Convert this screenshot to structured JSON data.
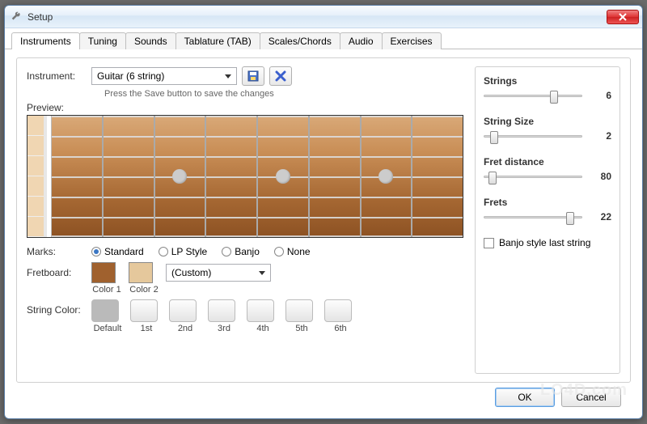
{
  "window": {
    "title": "Setup"
  },
  "tabs": {
    "items": [
      {
        "label": "Instruments",
        "active": true
      },
      {
        "label": "Tuning"
      },
      {
        "label": "Sounds"
      },
      {
        "label": "Tablature (TAB)"
      },
      {
        "label": "Scales/Chords"
      },
      {
        "label": "Audio"
      },
      {
        "label": "Exercises"
      }
    ]
  },
  "instrument": {
    "label": "Instrument:",
    "value": "Guitar (6 string)",
    "hint": "Press the Save button to save the changes"
  },
  "preview": {
    "label": "Preview:"
  },
  "marks": {
    "label": "Marks:",
    "options": [
      {
        "label": "Standard",
        "checked": true
      },
      {
        "label": "LP Style",
        "checked": false
      },
      {
        "label": "Banjo",
        "checked": false
      },
      {
        "label": "None",
        "checked": false
      }
    ]
  },
  "fretboard": {
    "label": "Fretboard:",
    "color1": "#a0612e",
    "color2": "#e5c89c",
    "custom_label": "(Custom)",
    "col1_label": "Color 1",
    "col2_label": "Color 2"
  },
  "string_color": {
    "label": "String Color:",
    "labels": [
      "Default",
      "1st",
      "2nd",
      "3rd",
      "4th",
      "5th",
      "6th"
    ]
  },
  "sliders": {
    "strings": {
      "title": "Strings",
      "value": "6",
      "pct": 72
    },
    "string_size": {
      "title": "String Size",
      "value": "2",
      "pct": 10
    },
    "fret_distance": {
      "title": "Fret distance",
      "value": "80",
      "pct": 8
    },
    "frets": {
      "title": "Frets",
      "value": "22",
      "pct": 88
    }
  },
  "banjo_checkbox": {
    "label": "Banjo style last string",
    "checked": false
  },
  "footer": {
    "ok": "OK",
    "cancel": "Cancel"
  },
  "watermark": "LO4D.com"
}
